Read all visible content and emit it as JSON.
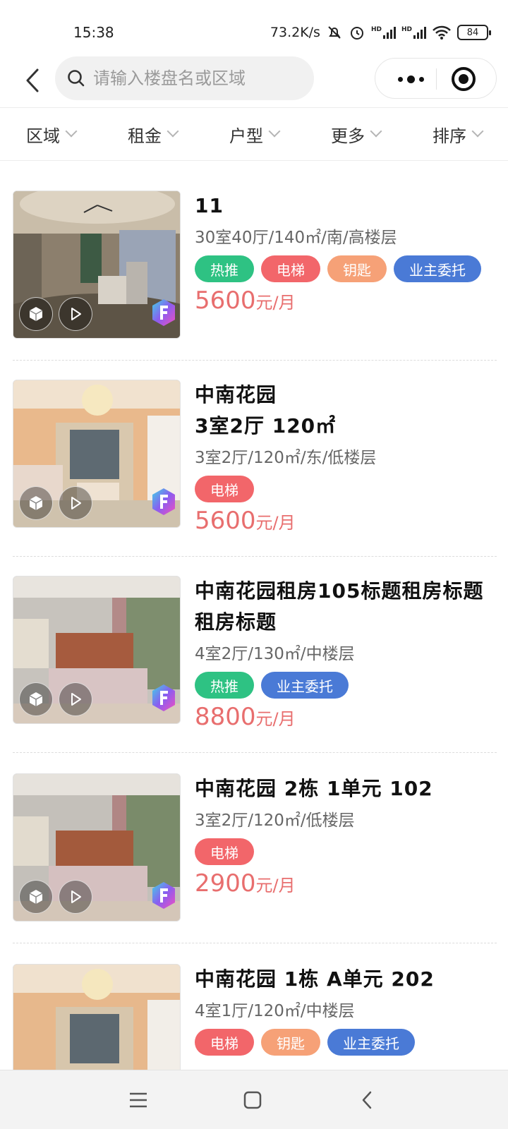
{
  "status": {
    "time": "15:38",
    "speed": "73.2K/s",
    "network_label": "HD",
    "battery": "84"
  },
  "header": {
    "search_placeholder": "请输入楼盘名或区域",
    "icons": [
      "back-chevron-icon",
      "search-icon",
      "more-dots-icon",
      "close-target-icon"
    ]
  },
  "filters": [
    {
      "label": "区域"
    },
    {
      "label": "租金"
    },
    {
      "label": "户型"
    },
    {
      "label": "更多"
    },
    {
      "label": "排序"
    }
  ],
  "listings": [
    {
      "title": "11",
      "specs": "30室40厅/140㎡/南/高楼层",
      "tags": [
        {
          "label": "热推",
          "kind": "hot"
        },
        {
          "label": "电梯",
          "kind": "elev"
        },
        {
          "label": "钥匙",
          "kind": "key"
        },
        {
          "label": "业主委托",
          "kind": "owner"
        }
      ],
      "price": "5600",
      "price_unit": "元/月"
    },
    {
      "title": "中南花园\n3室2厅 120㎡",
      "specs": "3室2厅/120㎡/东/低楼层",
      "tags": [
        {
          "label": "电梯",
          "kind": "elev"
        }
      ],
      "price": "5600",
      "price_unit": "元/月"
    },
    {
      "title": "中南花园租房105标题租房标题租房标题",
      "specs": "4室2厅/130㎡/中楼层",
      "tags": [
        {
          "label": "热推",
          "kind": "hot"
        },
        {
          "label": "业主委托",
          "kind": "owner"
        }
      ],
      "price": "8800",
      "price_unit": "元/月"
    },
    {
      "title": "中南花园 2栋 1单元 102",
      "specs": "3室2厅/120㎡/低楼层",
      "tags": [
        {
          "label": "电梯",
          "kind": "elev"
        }
      ],
      "price": "2900",
      "price_unit": "元/月"
    },
    {
      "title": "中南花园 1栋 A单元 202",
      "specs": "4室1厅/120㎡/中楼层",
      "tags": [
        {
          "label": "电梯",
          "kind": "elev"
        },
        {
          "label": "钥匙",
          "kind": "key"
        },
        {
          "label": "业主委托",
          "kind": "owner"
        }
      ],
      "price": "",
      "price_unit": ""
    }
  ],
  "colors": {
    "price": "#e86e6e",
    "tag_hot": "#2ec283",
    "tag_elevator": "#f2666a",
    "tag_key": "#f6a177",
    "tag_owner": "#4a7ad6"
  }
}
